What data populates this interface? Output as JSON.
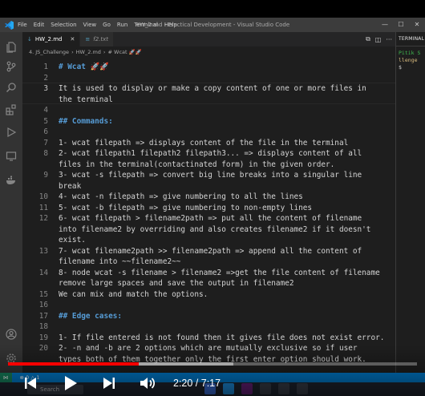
{
  "window": {
    "title": "HW_2.md - Practical Development - Visual Studio Code"
  },
  "menu": [
    "File",
    "Edit",
    "Selection",
    "View",
    "Go",
    "Run",
    "Terminal",
    "Help"
  ],
  "tabs": [
    {
      "label": "HW_2.md",
      "icon": "markdown-icon",
      "active": true
    },
    {
      "label": "f2.txt",
      "icon": "text-file-icon",
      "active": false
    }
  ],
  "breadcrumb": [
    "4. JS_Challenge",
    "HW_2.md",
    "# Wcat 🚀🚀"
  ],
  "editor": {
    "lines": [
      {
        "n": "1",
        "text": "# Wcat 🚀🚀",
        "type": "heading"
      },
      {
        "n": "2",
        "text": "",
        "type": "text"
      },
      {
        "n": "3",
        "text": "It is used to display or make a copy content of one or more files in",
        "type": "text"
      },
      {
        "n": "",
        "text": "the terminal",
        "type": "text"
      },
      {
        "n": "4",
        "text": "",
        "type": "text"
      },
      {
        "n": "5",
        "text": "## Commands:",
        "type": "heading"
      },
      {
        "n": "6",
        "text": "",
        "type": "text"
      },
      {
        "n": "7",
        "text": "1- wcat filepath => displays content of the file in the terminal",
        "type": "text"
      },
      {
        "n": "8",
        "text": "2- wcat filepath1 filepath2 filepath3... => displays content of all",
        "type": "text"
      },
      {
        "n": "",
        "text": "files in the terminal(contactinated form) in the given order.",
        "type": "text"
      },
      {
        "n": "9",
        "text": "3- wcat -s filepath => convert big line breaks into a singular line",
        "type": "text"
      },
      {
        "n": "",
        "text": "break",
        "type": "text"
      },
      {
        "n": "10",
        "text": "4- wcat -n filepath => give numbering to all the lines",
        "type": "text"
      },
      {
        "n": "11",
        "text": "5- wcat -b filepath => give numbering to non-empty lines",
        "type": "text"
      },
      {
        "n": "12",
        "text": "6- wcat filepath > filename2path => put all the content of filename",
        "type": "text"
      },
      {
        "n": "",
        "text": "into filename2 by overriding and also creates filename2 if it doesn't",
        "type": "text"
      },
      {
        "n": "",
        "text": "exist.",
        "type": "text"
      },
      {
        "n": "13",
        "text": "7- wcat filename2path >> filename2path => append all the content of",
        "type": "text"
      },
      {
        "n": "",
        "text": "filename into ~~filename2~~",
        "type": "text"
      },
      {
        "n": "14",
        "text": "8- node wcat -s filename > filename2 =>get the file content of filename",
        "type": "text"
      },
      {
        "n": "",
        "text": "remove large spaces and save the output in filename2",
        "type": "text"
      },
      {
        "n": "15",
        "text": "We can mix and match the options.",
        "type": "text"
      },
      {
        "n": "16",
        "text": "",
        "type": "text"
      },
      {
        "n": "17",
        "text": "## Edge cases:",
        "type": "heading"
      },
      {
        "n": "18",
        "text": "",
        "type": "text"
      },
      {
        "n": "19",
        "text": "1- If file entered is not found then it gives file does not exist error.",
        "type": "text"
      },
      {
        "n": "20",
        "text": "2- -n and -b are 2 options which are mutually exclusive so if user",
        "type": "text"
      },
      {
        "n": "",
        "text": "types both of them together only the first enter option should work.",
        "type": "text"
      }
    ]
  },
  "terminal": {
    "header": "TERMINAL",
    "lines": [
      "Pitik S",
      "llenge",
      "$"
    ]
  },
  "statusbar": {
    "errors": "0",
    "warnings": "1"
  },
  "taskbar": {
    "search_label": "Search"
  },
  "video": {
    "current_time": "2:20",
    "total_time": "7:17",
    "timecode": "2:20 / 7:17",
    "played_fraction": 0.3204,
    "buffered_fraction": 0.55,
    "accent_color": "#ff0000"
  }
}
